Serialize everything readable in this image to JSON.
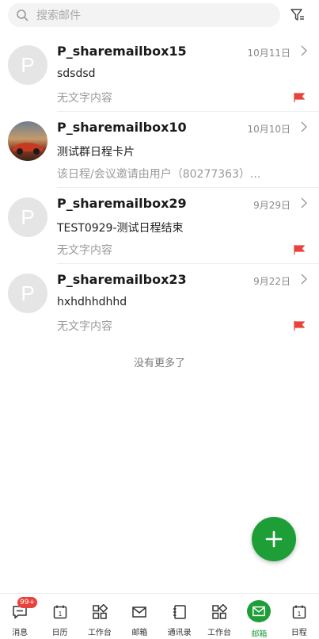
{
  "search": {
    "placeholder": "搜索邮件"
  },
  "mails": [
    {
      "sender": "P_sharemailbox15",
      "date": "10月11日",
      "subject": "sdsdsd",
      "preview": "无文字内容",
      "avatar_letter": "P",
      "flagged": true
    },
    {
      "sender": "P_sharemailbox10",
      "date": "10月10日",
      "subject": "测试群日程卡片",
      "preview": "该日程/会议邀请由用户（80277363）...",
      "avatar_letter": "",
      "flagged": false
    },
    {
      "sender": "P_sharemailbox29",
      "date": "9月29日",
      "subject": "TEST0929-测试日程结束",
      "preview": "无文字内容",
      "avatar_letter": "P",
      "flagged": true
    },
    {
      "sender": "P_sharemailbox23",
      "date": "9月22日",
      "subject": "hxhdhhdhhd",
      "preview": "无文字内容",
      "avatar_letter": "P",
      "flagged": true
    }
  ],
  "list_end": "没有更多了",
  "tabs": [
    {
      "label": "消息",
      "icon": "message-icon",
      "badge": "99+"
    },
    {
      "label": "日历",
      "icon": "calendar-icon",
      "day": "1"
    },
    {
      "label": "工作台",
      "icon": "grid-icon"
    },
    {
      "label": "邮箱",
      "icon": "mail-icon"
    },
    {
      "label": "通讯录",
      "icon": "contacts-icon"
    },
    {
      "label": "工作台",
      "icon": "grid-icon"
    },
    {
      "label": "邮箱",
      "icon": "mail-icon",
      "active": true
    },
    {
      "label": "日程",
      "icon": "calendar-icon",
      "day": "1"
    }
  ],
  "colors": {
    "accent": "#1e9e37",
    "flag": "#e8423a",
    "badge": "#e8423a"
  }
}
